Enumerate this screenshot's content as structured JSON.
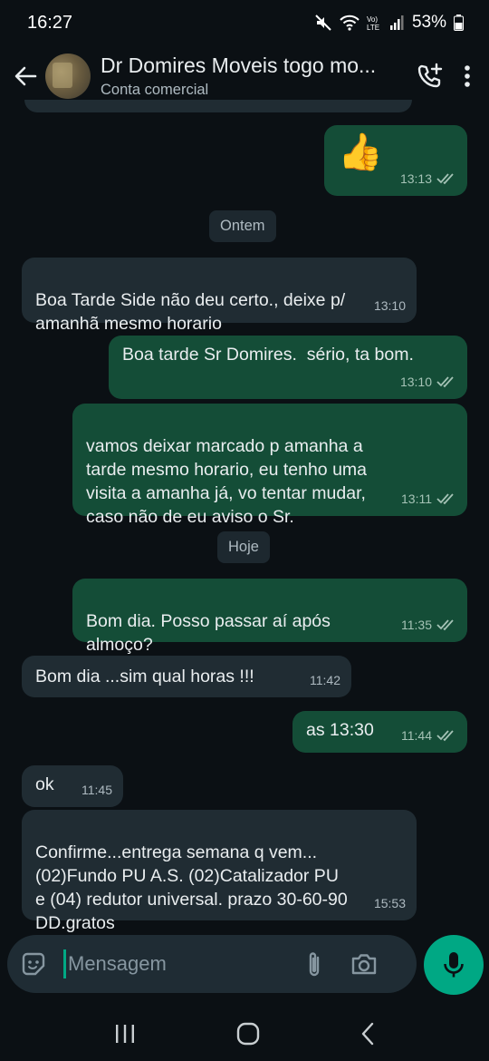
{
  "status_bar": {
    "time": "16:27",
    "battery": "53%",
    "icons": [
      "mute-icon",
      "wifi-icon",
      "volte-icon",
      "signal-icon",
      "battery-icon"
    ]
  },
  "header": {
    "contact_name": "Dr Domires Moveis togo mo...",
    "subtitle": "Conta comercial",
    "icons": [
      "back-arrow-icon",
      "add-call-icon",
      "more-vert-icon"
    ]
  },
  "chat": {
    "date_chips": [
      "Ontem",
      "Hoje"
    ],
    "messages": [
      {
        "dir": "out",
        "text": "👍",
        "time": "13:13",
        "ticks": "read"
      },
      {
        "dir": "in",
        "text": "Boa Tarde Side não deu certo., deixe p/\namanhã mesmo horario",
        "time": "13:10"
      },
      {
        "dir": "out",
        "text": "Boa tarde Sr Domires.  sério, ta bom.",
        "time": "13:10",
        "ticks": "read"
      },
      {
        "dir": "out",
        "text": "vamos deixar marcado p amanha a\ntarde mesmo horario, eu tenho uma\nvisita a amanha já, vo tentar mudar,\ncaso não de eu aviso o Sr.",
        "time": "13:11",
        "ticks": "read"
      },
      {
        "dir": "out",
        "text": "Bom dia.  Posso passar aí após\nalmoço?",
        "time": "11:35",
        "ticks": "read"
      },
      {
        "dir": "in",
        "text": "Bom dia ...sim qual horas !!!",
        "time": "11:42"
      },
      {
        "dir": "out",
        "text": "as 13:30",
        "time": "11:44",
        "ticks": "read"
      },
      {
        "dir": "in",
        "text": "ok",
        "time": "11:45"
      },
      {
        "dir": "in",
        "text": "Confirme...entrega semana q vem...\n(02)Fundo PU A.S.  (02)Catalizador PU\ne (04) redutor universal. prazo 30-60-90\nDD.gratos",
        "time": "15:53"
      }
    ]
  },
  "composer": {
    "placeholder": "Mensagem",
    "icons": [
      "sticker-icon",
      "attach-icon",
      "camera-icon",
      "mic-icon"
    ]
  },
  "colors": {
    "background": "#0b1014",
    "outgoing_bubble": "#144d37",
    "incoming_bubble": "#202c33",
    "accent": "#00a884"
  }
}
